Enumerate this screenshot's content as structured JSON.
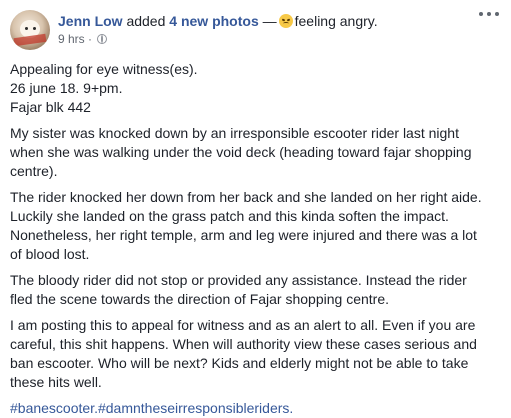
{
  "post": {
    "author": "Jenn Low",
    "action_prefix": "added",
    "action_link": "4 new photos",
    "separator": "—",
    "feeling_icon": "angry-face-emoji",
    "feeling": "feeling angry.",
    "time": "9 hrs",
    "meta_sep": "·",
    "audience_icon": "globe-icon",
    "more_icon": "more-options-icon"
  },
  "paragraphs": [
    [
      "Appealing for eye witness(es).",
      "26 june 18. 9+pm.",
      "Fajar blk 442"
    ],
    [
      "My sister was knocked down by an irresponsible escooter rider last night",
      "when she was walking under the void deck (heading toward fajar shopping",
      "centre)."
    ],
    [
      "The rider knocked her down from her back and she landed on her right aide.",
      "Luckily she landed on the grass patch and this kinda soften the impact.",
      "Nonetheless, her right temple, arm and leg were injured and there was a lot",
      "of blood lost."
    ],
    [
      "The bloody rider did not stop or provided any assistance. Instead the rider",
      "fled the scene towards the direction of Fajar shopping centre."
    ],
    [
      "I am posting this to appeal for witness and as an alert to all. Even if you are",
      "careful, this shit happens. When will authority view these cases serious and",
      "ban escooter. Who will be next? Kids and elderly might not be able to take",
      "these hits well."
    ]
  ],
  "hashtags": [
    "#banescooter",
    ".",
    "#damntheseirresponsibleriders",
    "."
  ]
}
